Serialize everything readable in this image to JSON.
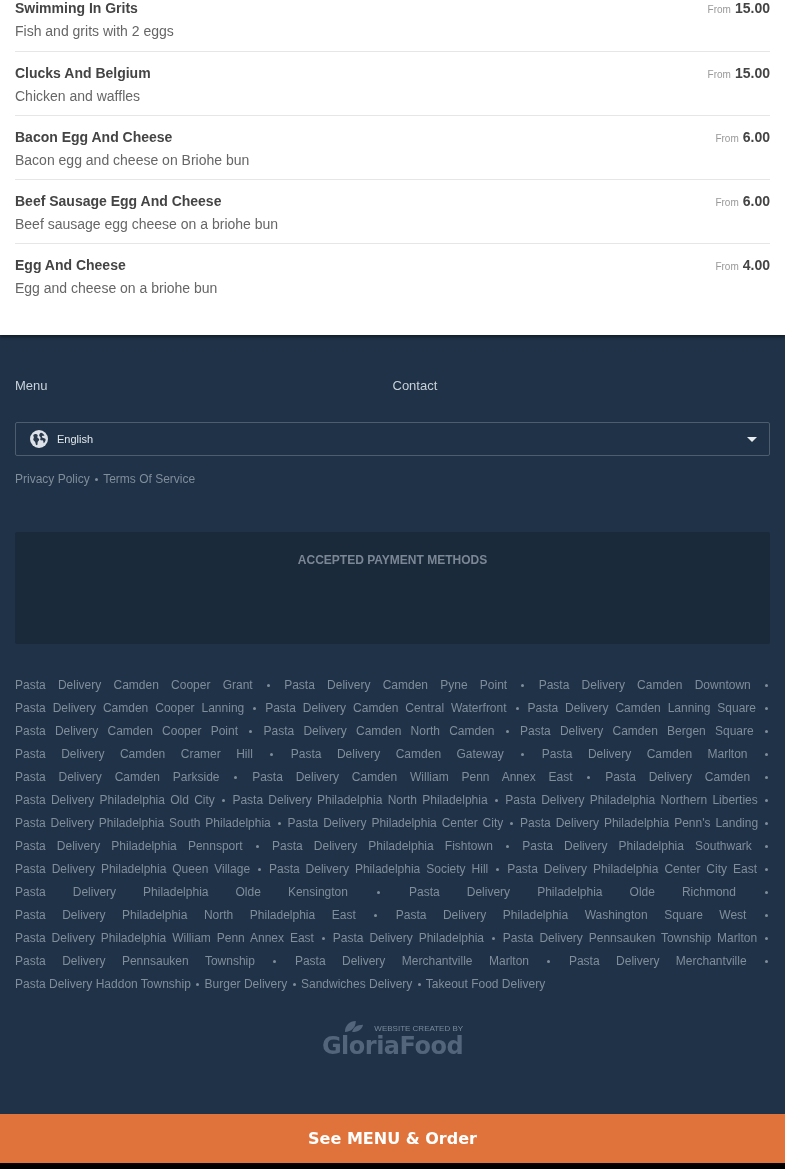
{
  "menu_items": [
    {
      "name": "Swimming In Grits",
      "description": "Fish and grits with 2 eggs",
      "price_prefix": "From",
      "price": "15.00"
    },
    {
      "name": "Clucks And Belgium",
      "description": "Chicken and waffles",
      "price_prefix": "From",
      "price": "15.00"
    },
    {
      "name": "Bacon Egg And Cheese",
      "description": "Bacon egg and cheese on Briohe bun",
      "price_prefix": "From",
      "price": "6.00"
    },
    {
      "name": "Beef Sausage Egg And Cheese",
      "description": "Beef sausage egg cheese on a briohe bun",
      "price_prefix": "From",
      "price": "6.00"
    },
    {
      "name": "Egg And Cheese",
      "description": "Egg and cheese on a briohe bun",
      "price_prefix": "From",
      "price": "4.00"
    }
  ],
  "footer": {
    "nav_links": [
      "Menu",
      "Contact"
    ],
    "language_select": {
      "value": "English"
    },
    "legal_links": [
      "Privacy Policy",
      "Terms Of Service"
    ],
    "payment_methods": {
      "title": "ACCEPTED PAYMENT METHODS"
    },
    "area_links": [
      "Pasta Delivery Camden Cooper Grant",
      "Pasta Delivery Camden Pyne Point",
      "Pasta Delivery Camden Downtown",
      "Pasta Delivery Camden Cooper Lanning",
      "Pasta Delivery Camden Central Waterfront",
      "Pasta Delivery Camden Lanning Square",
      "Pasta Delivery Camden Cooper Point",
      "Pasta Delivery Camden North Camden",
      "Pasta Delivery Camden Bergen Square",
      "Pasta Delivery Camden Cramer Hill",
      "Pasta Delivery Camden Gateway",
      "Pasta Delivery Camden Marlton",
      "Pasta Delivery Camden Parkside",
      "Pasta Delivery Camden William Penn Annex East",
      "Pasta Delivery Camden",
      "Pasta Delivery Philadelphia Old City",
      "Pasta Delivery Philadelphia North Philadelphia",
      "Pasta Delivery Philadelphia Northern Liberties",
      "Pasta Delivery Philadelphia South Philadelphia",
      "Pasta Delivery Philadelphia Center City",
      "Pasta Delivery Philadelphia Penn's Landing",
      "Pasta Delivery Philadelphia Pennsport",
      "Pasta Delivery Philadelphia Fishtown",
      "Pasta Delivery Philadelphia Southwark",
      "Pasta Delivery Philadelphia Queen Village",
      "Pasta Delivery Philadelphia Society Hill",
      "Pasta Delivery Philadelphia Center City East",
      "Pasta Delivery Philadelphia Olde Kensington",
      "Pasta Delivery Philadelphia Olde Richmond",
      "Pasta Delivery Philadelphia North Philadelphia East",
      "Pasta Delivery Philadelphia Washington Square West",
      "Pasta Delivery Philadelphia William Penn Annex East",
      "Pasta Delivery Philadelphia",
      "Pasta Delivery Pennsauken Township Marlton",
      "Pasta Delivery Pennsauken Township",
      "Pasta Delivery Merchantville Marlton",
      "Pasta Delivery Merchantville",
      "Pasta Delivery Haddon Township",
      "Burger Delivery",
      "Sandwiches Delivery",
      "Takeout Food Delivery"
    ],
    "credit": {
      "tagline": "WEBSITE CREATED BY",
      "brand": "GloriaFood"
    }
  },
  "order_bar": {
    "label": "See MENU & Order"
  }
}
